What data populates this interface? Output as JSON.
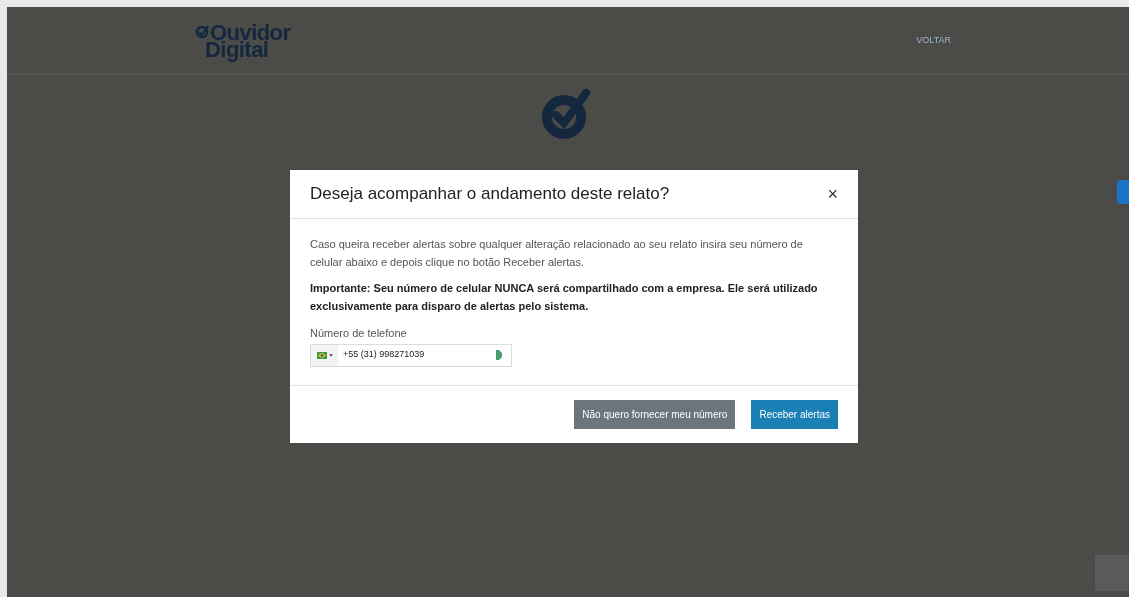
{
  "header": {
    "logo_line_1": "Ouvidor",
    "logo_line_2": "Digital",
    "back_link": "VOLTAR"
  },
  "modal": {
    "title": "Deseja acompanhar o andamento deste relato?",
    "close": "×",
    "description": "Caso queira receber alertas sobre qualquer alteração relacionado ao seu relato insira seu número de celular abaixo e depois clique no botão Receber alertas.",
    "notice": "Importante: Seu número de celular NUNCA será compartilhado com a empresa. Ele será utilizado exclusivamente para disparo de alertas pelo sistema.",
    "phone_label": "Número de telefone",
    "phone_value": "+55 (31) 998271039",
    "buttons": [
      {
        "kind": "secondary",
        "label": "Não quero fornecer meu número"
      },
      {
        "kind": "primary",
        "label": "Receber alertas"
      }
    ]
  }
}
